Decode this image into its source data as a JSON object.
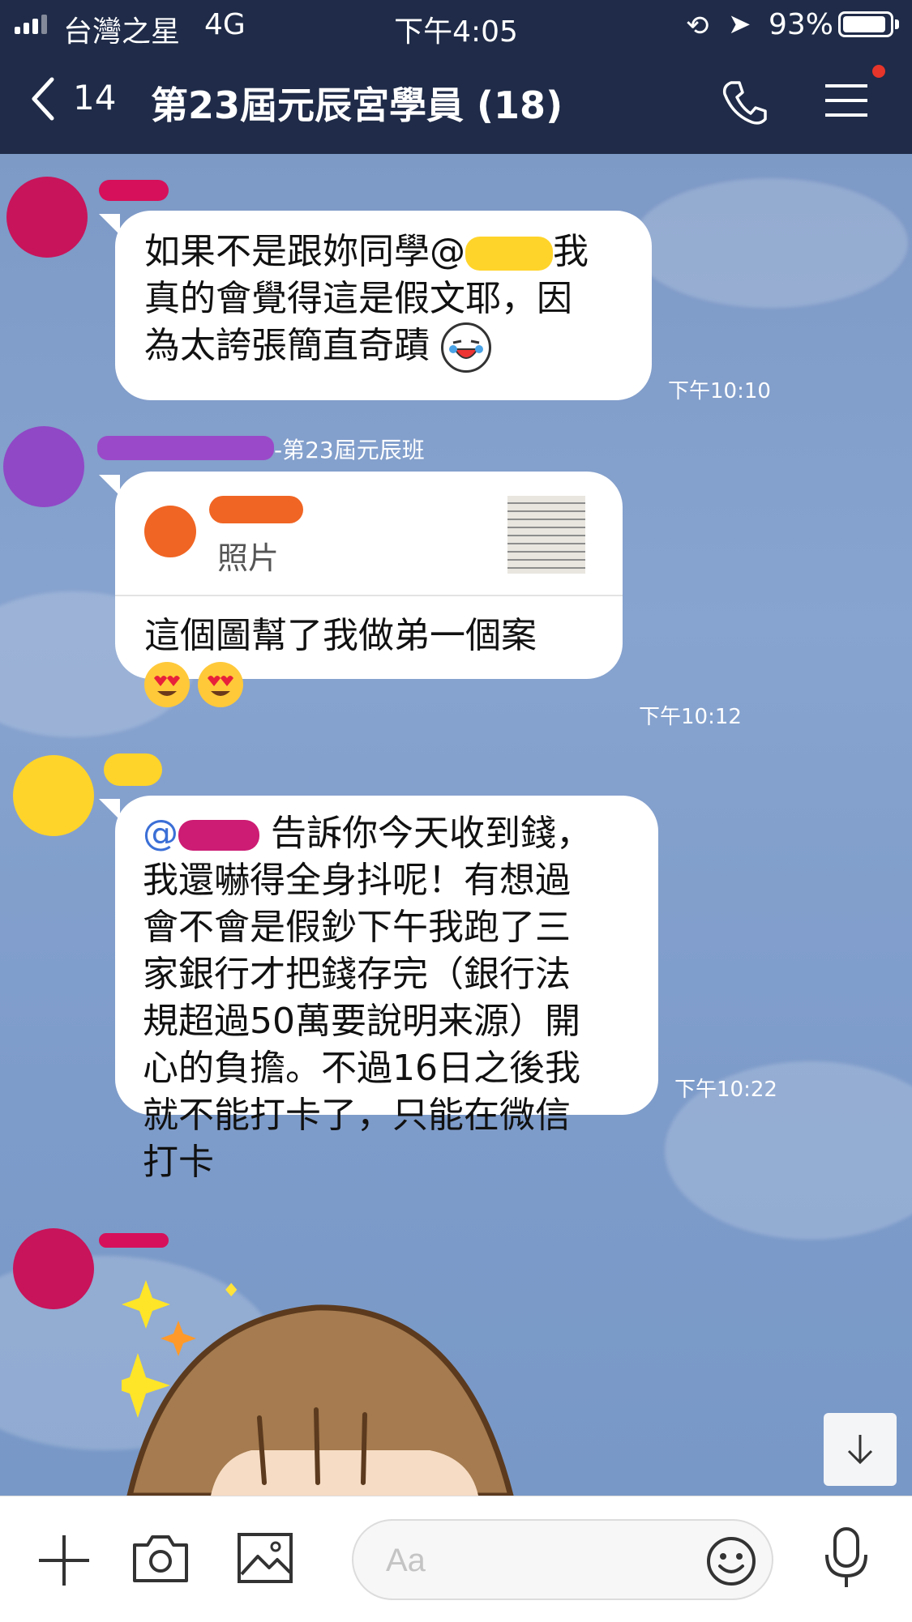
{
  "status_bar": {
    "carrier": "台灣之星",
    "network": "4G",
    "time": "下午4:05",
    "battery": "93%",
    "battery_level": 0.93
  },
  "header": {
    "back_count": "14",
    "title": "第23屆元辰宮學員 (18)"
  },
  "messages": [
    {
      "text_lines": [
        "如果不是跟妳同學@",
        "我",
        "真的會覺得這是假文耶，因",
        "為太誇張簡直奇蹟"
      ],
      "time": "下午10:10"
    },
    {
      "sender_suffix": "-第23屆元辰班",
      "reply_label": "照片",
      "text_lines": [
        "這個圖幫了我做弟一個案"
      ],
      "time": "下午10:12"
    },
    {
      "mention": "@",
      "text_lines": [
        "告訴你今天收到錢，",
        "我還嚇得全身抖呢！有想過",
        "會不會是假鈔下午我跑了三",
        "家銀行才把錢存完（銀行法",
        "規超過50萬要說明来源）開",
        "心的負擔。不過16日之後我",
        "就不能打卡了，只能在微信",
        "打卡"
      ],
      "time": "下午10:22"
    }
  ],
  "input": {
    "placeholder": "Aa"
  },
  "colors": {
    "header_bg": "#1f2b48",
    "chat_bg": "#7f9cc9",
    "mention": "#3b6fd6"
  },
  "icons": [
    "back-chevron-icon",
    "phone-icon",
    "menu-icon",
    "plus-icon",
    "camera-icon",
    "image-icon",
    "smile-icon",
    "microphone-icon",
    "arrow-down-icon"
  ]
}
